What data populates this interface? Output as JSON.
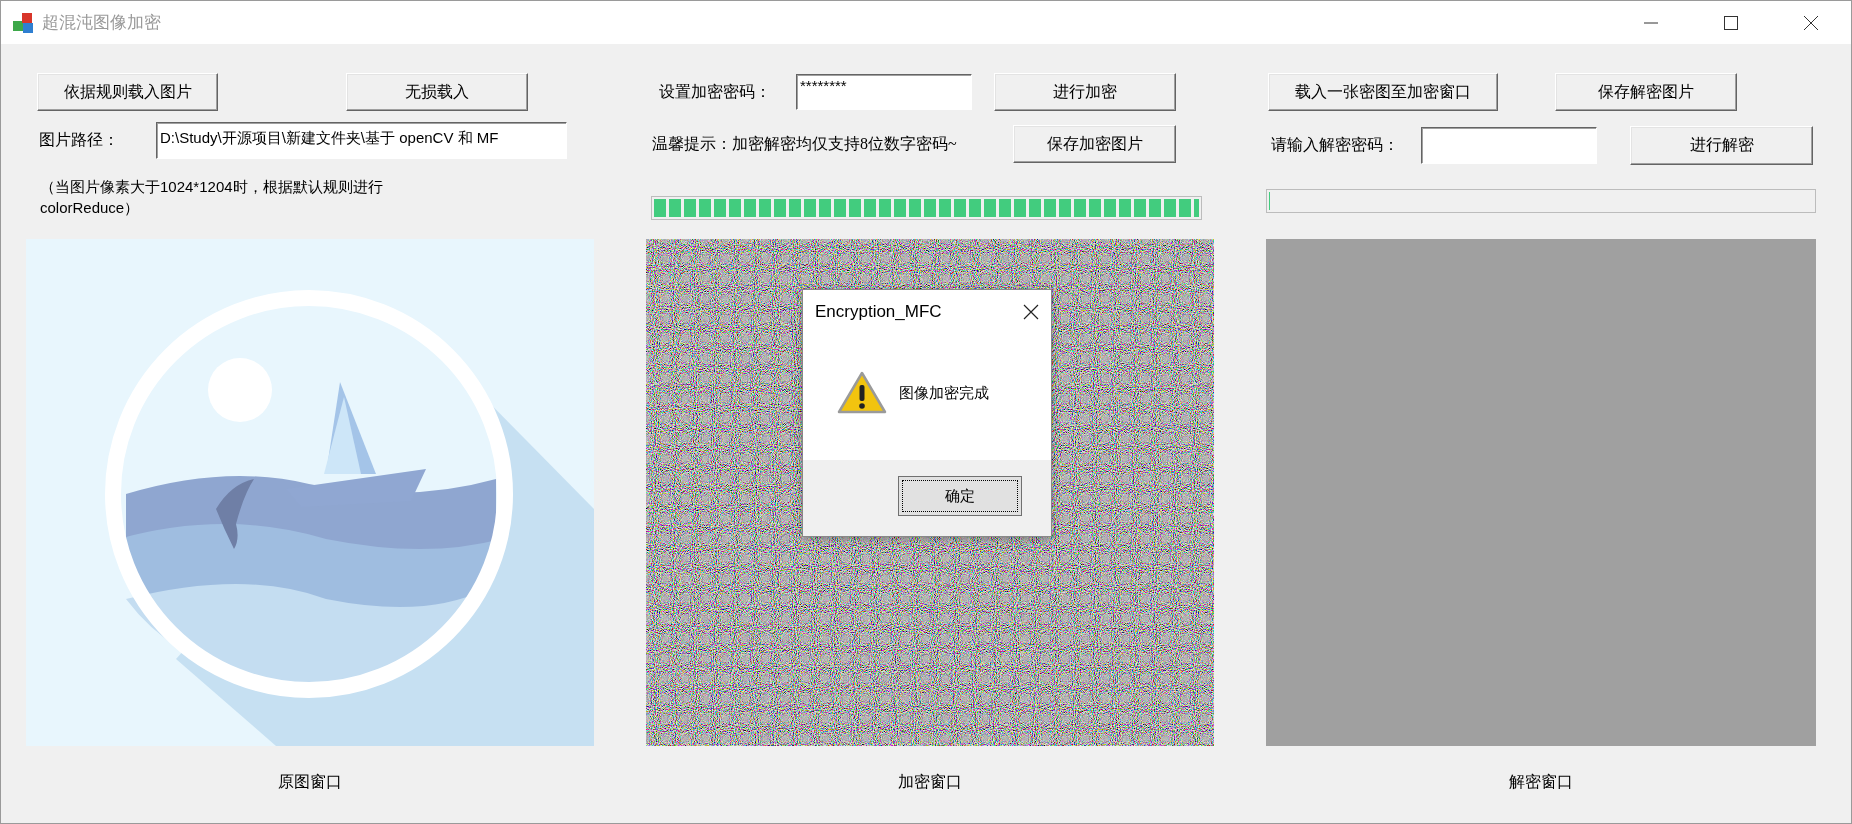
{
  "window": {
    "title": "超混沌图像加密"
  },
  "original_panel": {
    "buttons": [
      "依据规则载入图片",
      "无损载入"
    ],
    "path_label": "图片路径：",
    "path_value": "D:\\Study\\开源项目\\新建文件夹\\基于 openCV 和 MF",
    "note": "（当图片像素大于1024*1204时，根据默认规则进行colorReduce）",
    "caption": "原图窗口"
  },
  "encrypt_panel": {
    "password_label": "设置加密密码：",
    "password_value": "********",
    "encrypt_button": "进行加密",
    "hint": "温馨提示：加密解密均仅支持8位数字密码~",
    "save_button": "保存加密图片",
    "progress": {
      "level": 1
    },
    "caption": "加密窗口"
  },
  "decrypt_panel": {
    "load_button": "载入一张密图至加密窗口",
    "save_button": "保存解密图片",
    "password_label": "请输入解密密码：",
    "decrypt_button": "进行解密",
    "progress": {
      "level": 0
    },
    "caption": "解密窗口"
  },
  "dialog": {
    "title": "Encryption_MFC",
    "message": "图像加密完成",
    "ok_button": "确定"
  }
}
